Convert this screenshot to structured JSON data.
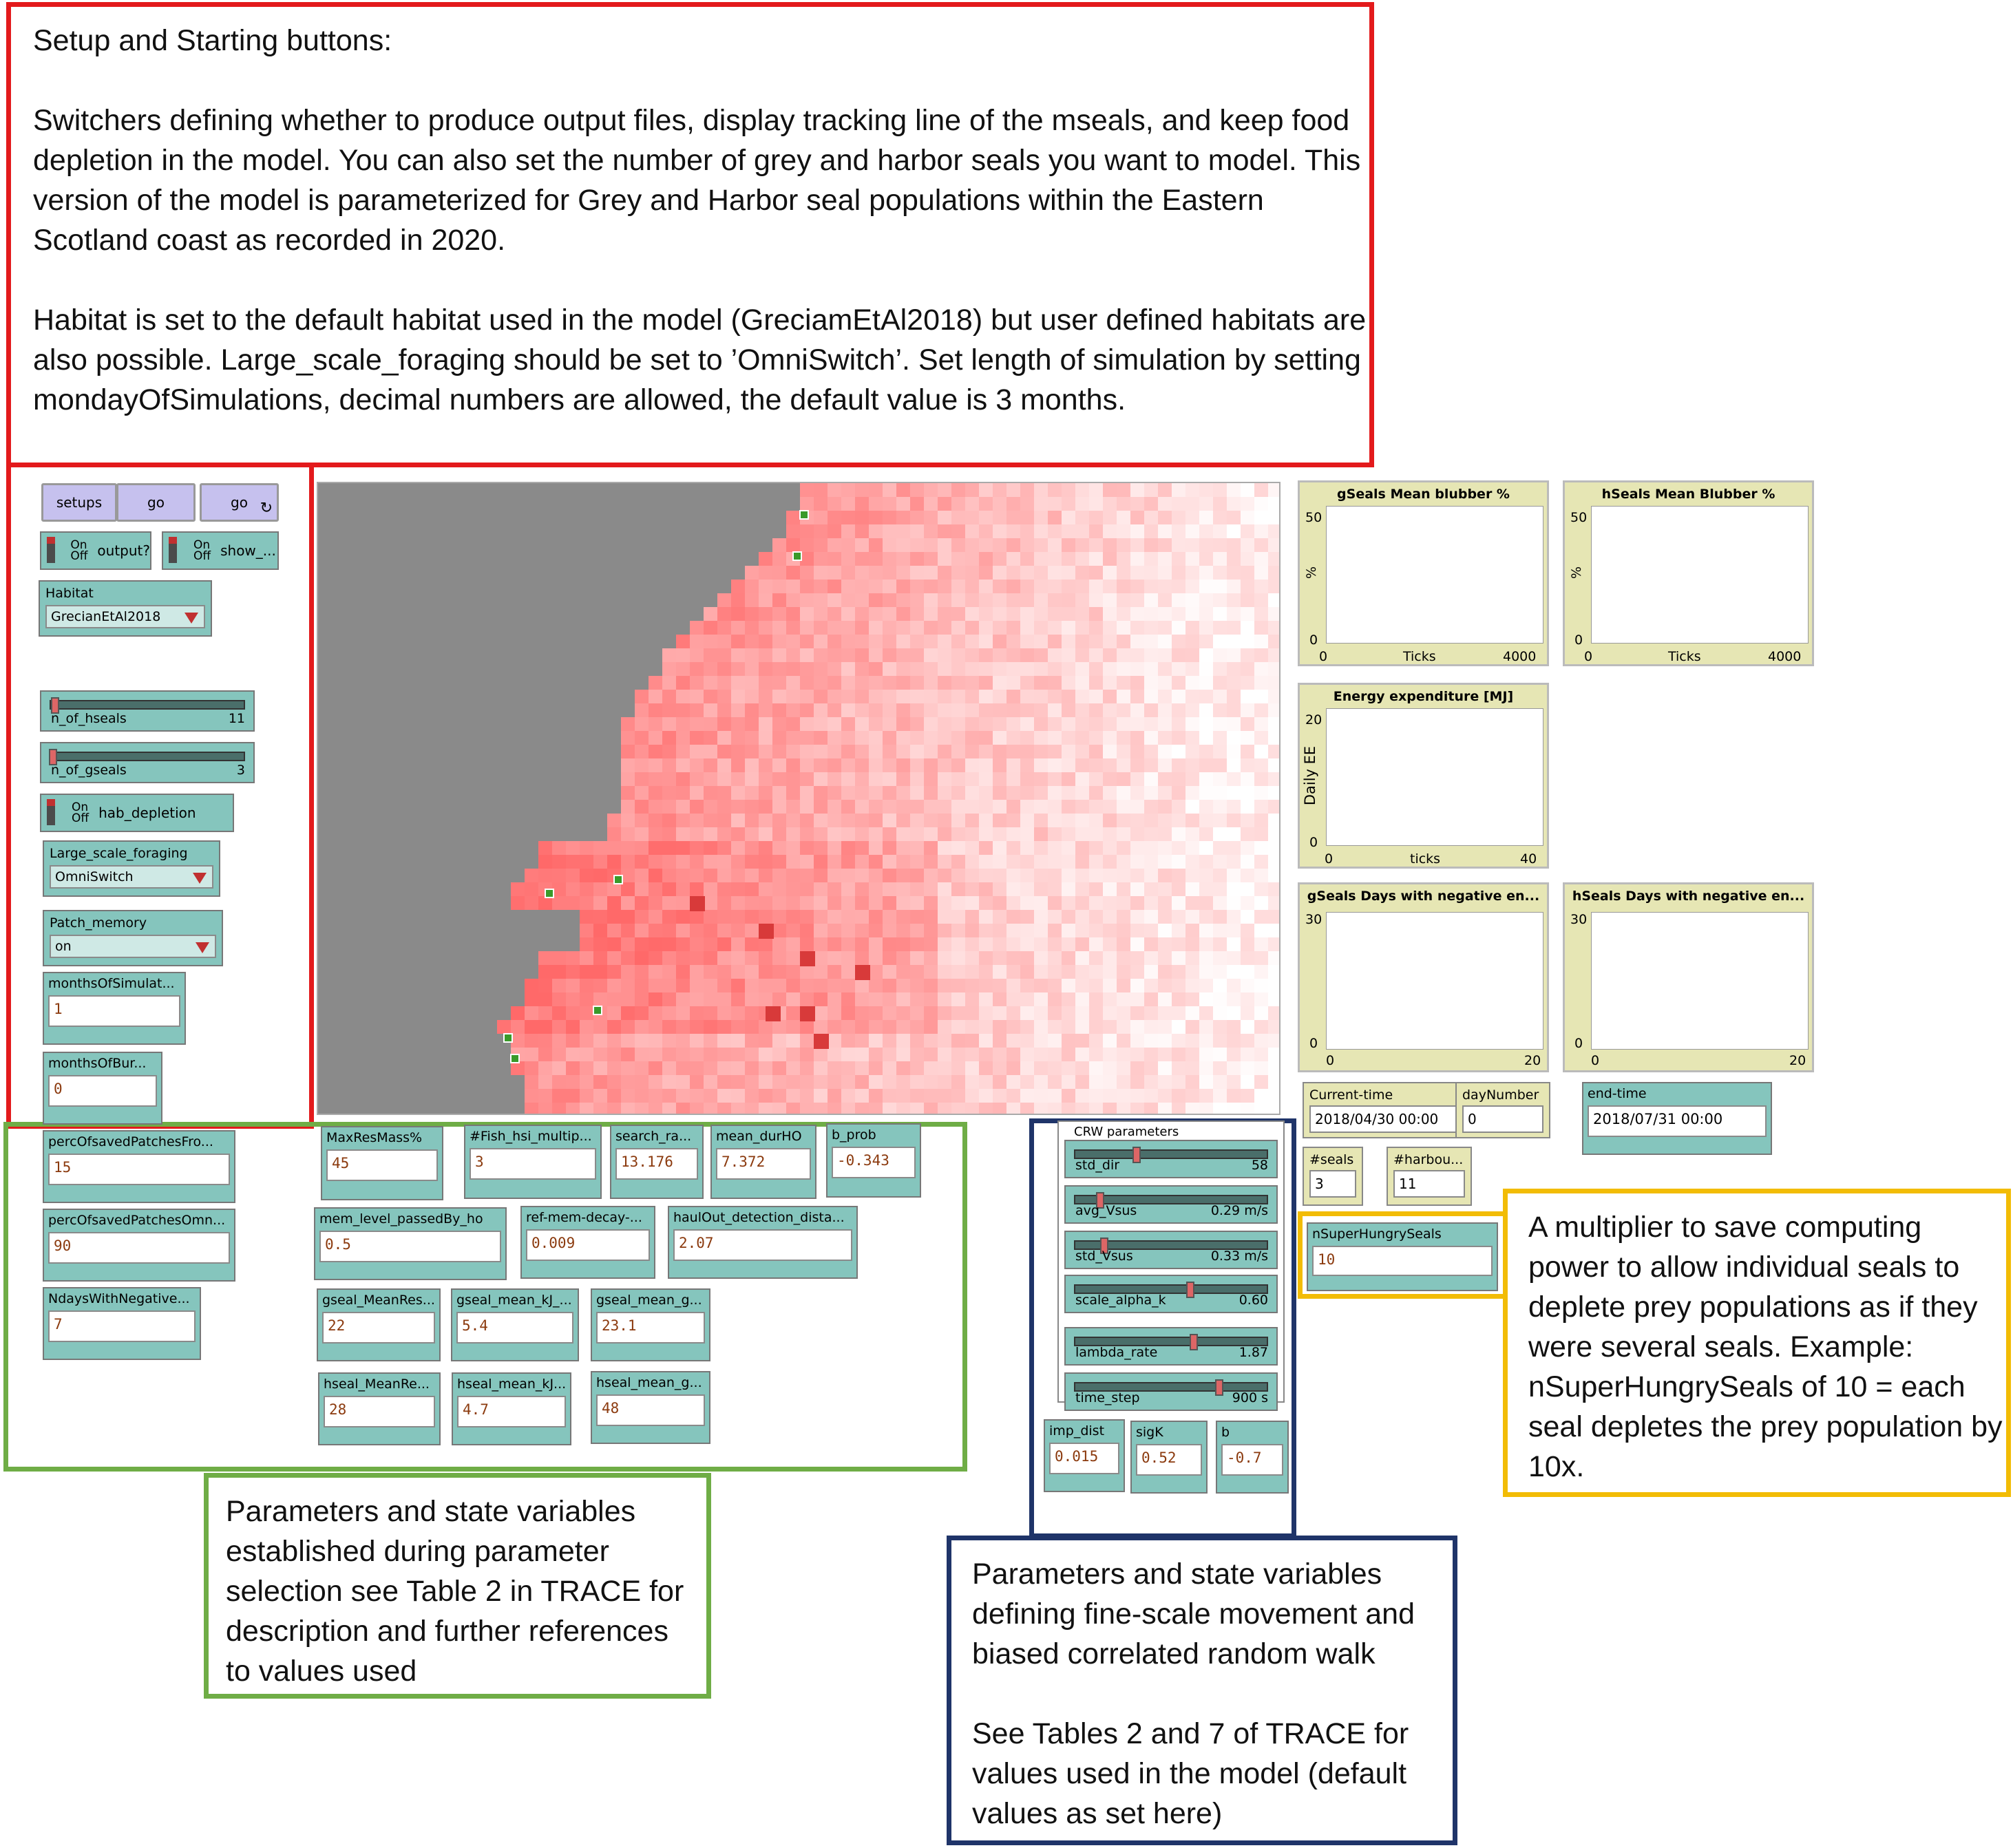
{
  "annotations": {
    "red": "Setup and Starting buttons:\n\nSwitchers defining whether to produce output files, display tracking line of the mseals, and keep food depletion in the model. You can also set the number of grey and harbor seals you want to model. This version of the model is parameterized for Grey and Harbor seal populations within the Eastern Scotland coast as recorded in 2020.\n\nHabitat is set to the default habitat used in the model (GreciamEtAl2018) but user defined habitats are also possible. Large_scale_foraging should be set to ’OmniSwitch’. Set length of simulation by setting mondayOfSimulations, decimal numbers are allowed, the default value is 3 months.",
    "green": "Parameters and state variables established during parameter selection see Table 2 in TRACE for description and further references to values used",
    "navy": "Parameters and state variables defining fine-scale movement and biased correlated random walk\n\nSee Tables 2 and 7 of TRACE for values used in the model (default values as set here)",
    "yellow": "A multiplier to save computing power to allow individual seals to deplete prey populations as if they were several seals. Example: nSuperHungrySeals of 10 = each seal depletes the prey population by 10x."
  },
  "buttons": {
    "setups": "setups",
    "go_once": "go",
    "go_forever": "go",
    "forever_icon": "↻"
  },
  "switches": {
    "onoff_on": "On",
    "onoff_off": "Off",
    "output": "output?",
    "show": "show_...",
    "hab_depletion": "hab_depletion"
  },
  "choosers": {
    "habitat": {
      "label": "Habitat",
      "value": "GrecianEtAl2018"
    },
    "large_scale": {
      "label": "Large_scale_foraging",
      "value": "OmniSwitch"
    },
    "patch_memory": {
      "label": "Patch_memory",
      "value": "on"
    }
  },
  "sliders": {
    "n_of_hseals": {
      "label": "n_of_hseals",
      "value": "11",
      "frac": 0.02
    },
    "n_of_gseals": {
      "label": "n_of_gseals",
      "value": "3",
      "frac": 0.01
    },
    "std_dir": {
      "label": "std_dir",
      "value": "58",
      "frac": 0.32
    },
    "avg_Vsus": {
      "label": "avg_Vsus",
      "value": "0.29 m/s",
      "frac": 0.13
    },
    "std_Vsus": {
      "label": "std_Vsus",
      "value": "0.33 m/s",
      "frac": 0.15
    },
    "scale_alpha_k": {
      "label": "scale_alpha_k",
      "value": "0.60",
      "frac": 0.6
    },
    "lambda_rate": {
      "label": "lambda_rate",
      "value": "1.87",
      "frac": 0.62
    },
    "time_step": {
      "label": "time_step",
      "value": "900 s",
      "frac": 0.75
    }
  },
  "inputs": {
    "monthsOfSimulat": {
      "label": "monthsOfSimulat...",
      "value": "1"
    },
    "monthsOfBur": {
      "label": "monthsOfBur...",
      "value": "0"
    },
    "percOfsavedPatchesFro": {
      "label": "percOfsavedPatchesFro...",
      "value": "15"
    },
    "percOfsavedPatchesOmn": {
      "label": "percOfsavedPatchesOmn...",
      "value": "90"
    },
    "NdaysWithNegative": {
      "label": "NdaysWithNegative...",
      "value": "7"
    },
    "MaxResMass": {
      "label": "MaxResMass%",
      "value": "45"
    },
    "Fish_hsi_multip": {
      "label": "#Fish_hsi_multip...",
      "value": "3"
    },
    "search_ra": {
      "label": "search_ra...",
      "value": "13.176"
    },
    "mean_durHO": {
      "label": "mean_durHO",
      "value": "7.372"
    },
    "b_prob": {
      "label": "b_prob",
      "value": "-0.343"
    },
    "mem_level_passedBy_ho": {
      "label": "mem_level_passedBy_ho",
      "value": "0.5"
    },
    "ref_mem_decay": {
      "label": "ref-mem-decay-...",
      "value": "0.009"
    },
    "haulOut_detection_dista": {
      "label": "haulOut_detection_dista...",
      "value": "2.07"
    },
    "gseal_MeanRes": {
      "label": "gseal_MeanRes...",
      "value": "22"
    },
    "gseal_mean_kJ": {
      "label": "gseal_mean_kJ_...",
      "value": "5.4"
    },
    "gseal_mean_g": {
      "label": "gseal_mean_g...",
      "value": "23.1"
    },
    "hseal_MeanRe": {
      "label": "hseal_MeanRe...",
      "value": "28"
    },
    "hseal_mean_kJ": {
      "label": "hseal_mean_kJ...",
      "value": "4.7"
    },
    "hseal_mean_g": {
      "label": "hseal_mean_g...",
      "value": "48"
    },
    "imp_dist": {
      "label": "imp_dist",
      "value": "0.015"
    },
    "sigK": {
      "label": "sigK",
      "value": "0.52"
    },
    "b": {
      "label": "b",
      "value": "-0.7"
    },
    "nSuperHungrySeals": {
      "label": "nSuperHungrySeals",
      "value": "10"
    }
  },
  "crw_title": "CRW parameters",
  "monitors": {
    "current_time": {
      "label": "Current-time",
      "value": "2018/04/30 00:00"
    },
    "dayNumber": {
      "label": "dayNumber",
      "value": "0"
    },
    "end_time": {
      "label": "end-time",
      "value": "2018/07/31 00:00"
    },
    "seals": {
      "label": "#seals",
      "value": "3"
    },
    "harbou": {
      "label": "#harbou...",
      "value": "11"
    }
  },
  "plots": {
    "gseals_blubber": {
      "title": "gSeals Mean blubber %",
      "ylabel": "%",
      "xlabel": "Ticks",
      "ymax": "50",
      "ymin": "0",
      "xmin": "0",
      "xmax": "4000"
    },
    "hseals_blubber": {
      "title": "hSeals Mean Blubber %",
      "ylabel": "%",
      "xlabel": "Ticks",
      "ymax": "50",
      "ymin": "0",
      "xmin": "0",
      "xmax": "4000"
    },
    "energy": {
      "title": "Energy expenditure [MJ]",
      "ylabel": "Daily EE",
      "xlabel": "ticks",
      "ymax": "20",
      "ymin": "0",
      "xmin": "0",
      "xmax": "40"
    },
    "gseals_neg": {
      "title": "gSeals Days with negative en...",
      "ylabel": "",
      "xlabel": "",
      "ymax": "30",
      "ymin": "0",
      "xmin": "0",
      "xmax": "20"
    },
    "hseals_neg": {
      "title": "hSeals Days with negative en...",
      "ylabel": "",
      "xlabel": "",
      "ymax": "30",
      "ymin": "0",
      "xmin": "0",
      "xmax": "20"
    }
  },
  "colors": {
    "button": "#c6c1ee",
    "widget": "#85c5bd",
    "plot_bg": "#e6e6b4",
    "land": "#8a8a8a",
    "red_box": "#e31a1c",
    "green_box": "#6fad46",
    "navy_box": "#1f3469",
    "yellow_box": "#f2bc05"
  }
}
